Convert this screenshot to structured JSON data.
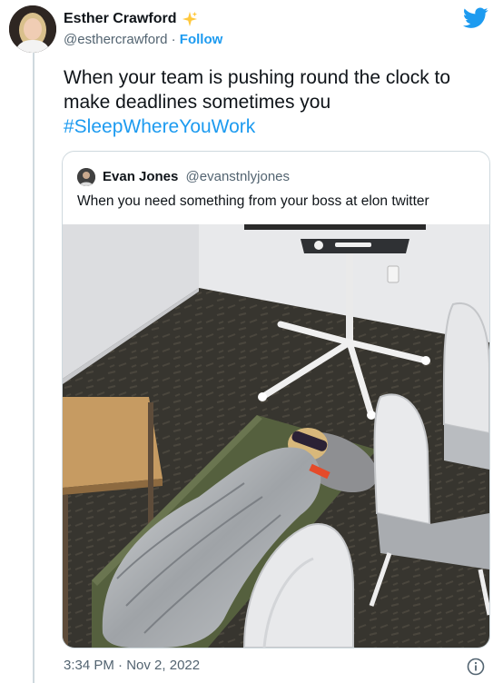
{
  "author": {
    "name": "Esther Crawford",
    "handle": "@esthercrawford",
    "follow_label": "Follow",
    "separator": "·"
  },
  "tweet": {
    "text_line1": "When your team is pushing round the clock to",
    "text_line2": "make deadlines sometimes you",
    "hashtag": "#SleepWhereYouWork"
  },
  "quoted": {
    "name": "Evan Jones",
    "handle": "@evanstnlyjones",
    "text": "When you need something from your boss at elon twitter"
  },
  "footer": {
    "time": "3:34 PM",
    "separator": "·",
    "date": "Nov 2, 2022"
  },
  "colors": {
    "link": "#1d9bf0",
    "text": "#0f1419",
    "muted": "#536471",
    "border": "#cfd9de"
  },
  "icons": {
    "brand": "twitter-bird-icon",
    "badge": "sparkle-icon",
    "info": "info-icon"
  }
}
